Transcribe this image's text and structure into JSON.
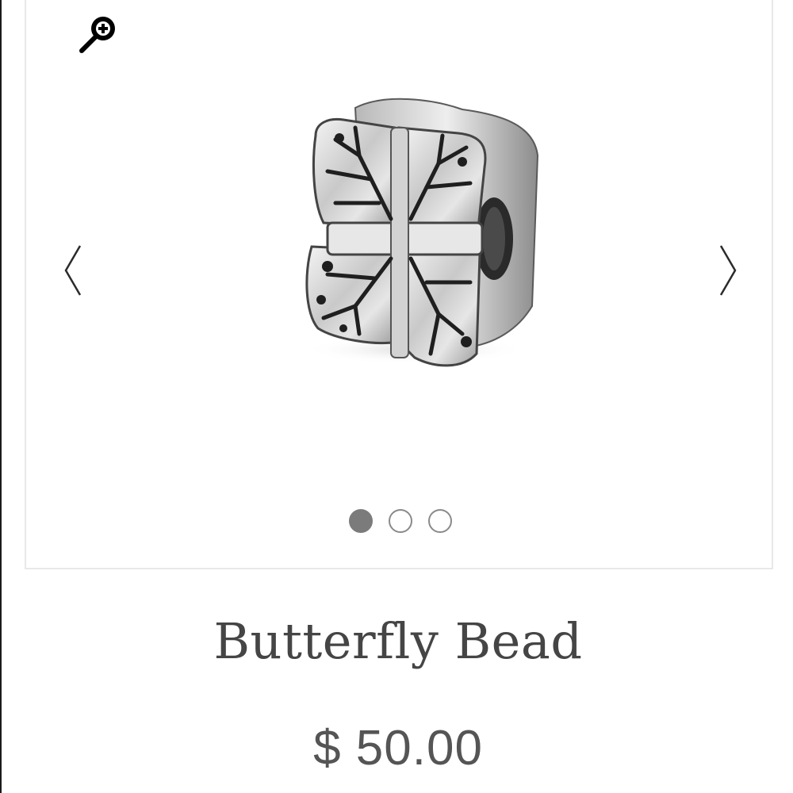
{
  "gallery": {
    "zoom_icon": "zoom-in-icon",
    "prev_icon": "chevron-left-icon",
    "next_icon": "chevron-right-icon",
    "image_count": 3,
    "active_index": 0,
    "dot_active_color": "#7b7b7b",
    "dot_inactive_border": "#8a8a8a"
  },
  "product": {
    "title": "Butterfly Bead",
    "price": "$ 50.00"
  }
}
